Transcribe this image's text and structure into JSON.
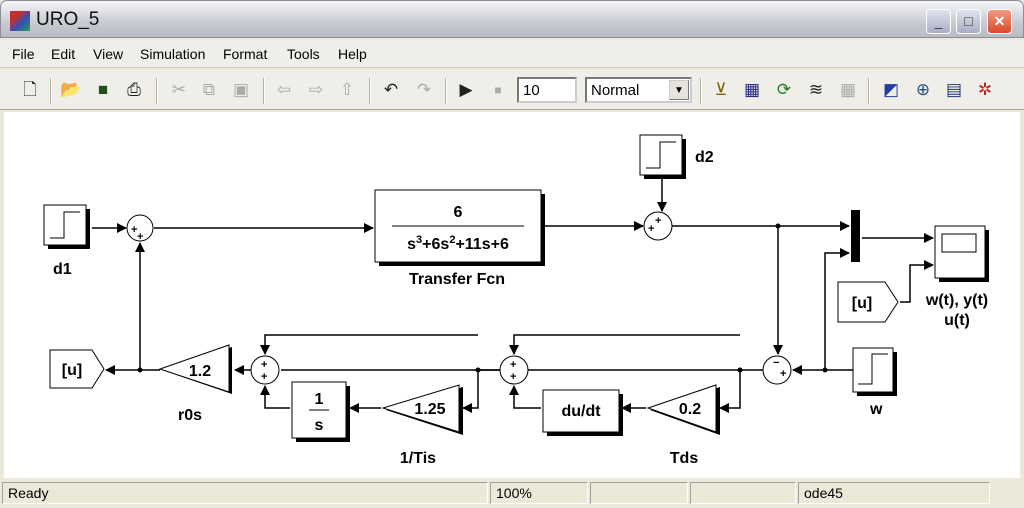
{
  "window": {
    "title": "URO_5",
    "minimize": "_",
    "maximize": "□",
    "close": "✕"
  },
  "menu": [
    "File",
    "Edit",
    "View",
    "Simulation",
    "Format",
    "Tools",
    "Help"
  ],
  "toolbar": {
    "stop_time": "10",
    "sim_mode": "Normal",
    "icons": [
      "new-icon",
      "open-icon",
      "save-icon",
      "print-icon",
      "cut-icon",
      "copy-icon",
      "paste-icon",
      "back-icon",
      "forward-icon",
      "up-icon",
      "undo-icon",
      "redo-icon",
      "play-icon",
      "stop-icon",
      "build-icon",
      "library-icon",
      "refresh-icon",
      "update-diagram-icon",
      "debug-icon",
      "model-browser-icon",
      "explorer-icon",
      "properties-icon",
      "debugger-icon"
    ]
  },
  "diagram": {
    "d1": "d1",
    "d2": "d2",
    "w": "w",
    "tf": {
      "num": "6",
      "den": [
        "s",
        "3",
        "+6s",
        "2",
        "+11s+6"
      ],
      "label": "Transfer Fcn"
    },
    "scope_label1": "w(t), y(t)",
    "scope_label2": "u(t)",
    "goto": "[u]",
    "from": "[u]",
    "gain_r0": {
      "value": "1.2",
      "label": "r0s"
    },
    "gain_ti": {
      "value": "1.25",
      "label": "1/Tis"
    },
    "gain_td": {
      "value": "0.2",
      "label": "Tds"
    },
    "integrator": {
      "num": "1",
      "den": "s"
    },
    "derivative": "du/dt",
    "plus": "+",
    "minus": "−"
  },
  "status": {
    "state": "Ready",
    "zoom": "100%",
    "solver": "ode45"
  }
}
